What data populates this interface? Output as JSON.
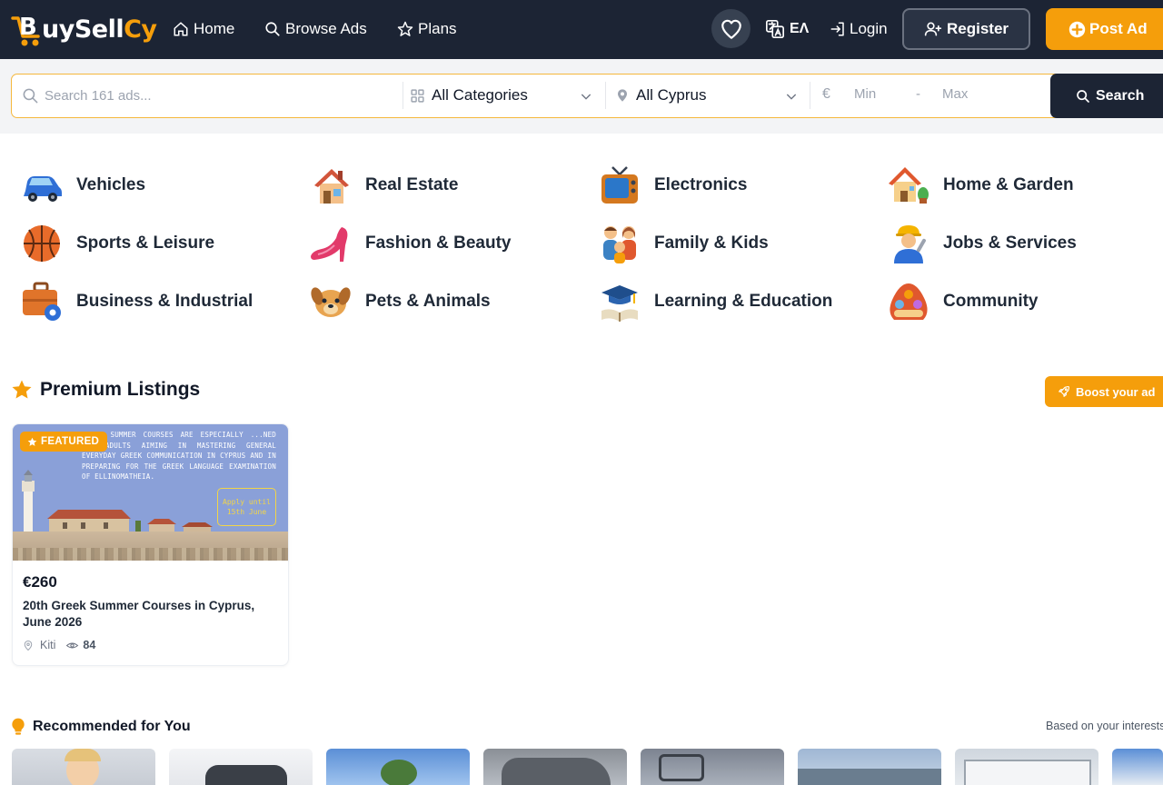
{
  "brand": {
    "name_prefix": "uySell",
    "name_suffix": "Cy",
    "accent": "#f59e0b",
    "navy": "#1c2434"
  },
  "nav": {
    "links": [
      {
        "label": "Home",
        "icon": "home-icon"
      },
      {
        "label": "Browse Ads",
        "icon": "search-icon"
      },
      {
        "label": "Plans",
        "icon": "star-icon"
      }
    ],
    "language": "ΕΛ",
    "login": "Login",
    "register": "Register",
    "post_ad": "Post Ad"
  },
  "search": {
    "placeholder": "Search 161 ads...",
    "category": "All Categories",
    "location": "All Cyprus",
    "currency": "€",
    "min_placeholder": "Min",
    "dash": "-",
    "max_placeholder": "Max",
    "button": "Search"
  },
  "categories": [
    {
      "label": "Vehicles",
      "icon": "car-icon"
    },
    {
      "label": "Real Estate",
      "icon": "house-icon"
    },
    {
      "label": "Electronics",
      "icon": "tv-icon"
    },
    {
      "label": "Home & Garden",
      "icon": "garden-house-icon"
    },
    {
      "label": "Sports & Leisure",
      "icon": "basketball-icon"
    },
    {
      "label": "Fashion & Beauty",
      "icon": "high-heel-icon"
    },
    {
      "label": "Family & Kids",
      "icon": "family-icon"
    },
    {
      "label": "Jobs & Services",
      "icon": "worker-icon"
    },
    {
      "label": "Business & Industrial",
      "icon": "briefcase-gear-icon"
    },
    {
      "label": "Pets & Animals",
      "icon": "dog-icon"
    },
    {
      "label": "Learning & Education",
      "icon": "graduation-cap-icon"
    },
    {
      "label": "Community",
      "icon": "people-group-icon"
    }
  ],
  "premium": {
    "title": "Premium Listings",
    "boost": "Boost your ad",
    "card": {
      "badge": "FEATURED",
      "image_text": "GREEK SUMMER COURSES ARE ESPECIALLY ...NED FOR ADULTS AIMING IN MASTERING GENERAL EVERYDAY GREEK COMMUNICATION IN CYPRUS AND IN PREPARING FOR THE GREEK LANGUAGE EXAMINATION OF ELLINOMATHEIA.",
      "image_apply_line1": "Apply until",
      "image_apply_line2": "15th June",
      "price": "€260",
      "title": "20th Greek Summer Courses in Cyprus, June 2026",
      "location": "Kiti",
      "views": "84"
    }
  },
  "recommended": {
    "title": "Recommended for You",
    "subtitle": "Based on your interests"
  }
}
